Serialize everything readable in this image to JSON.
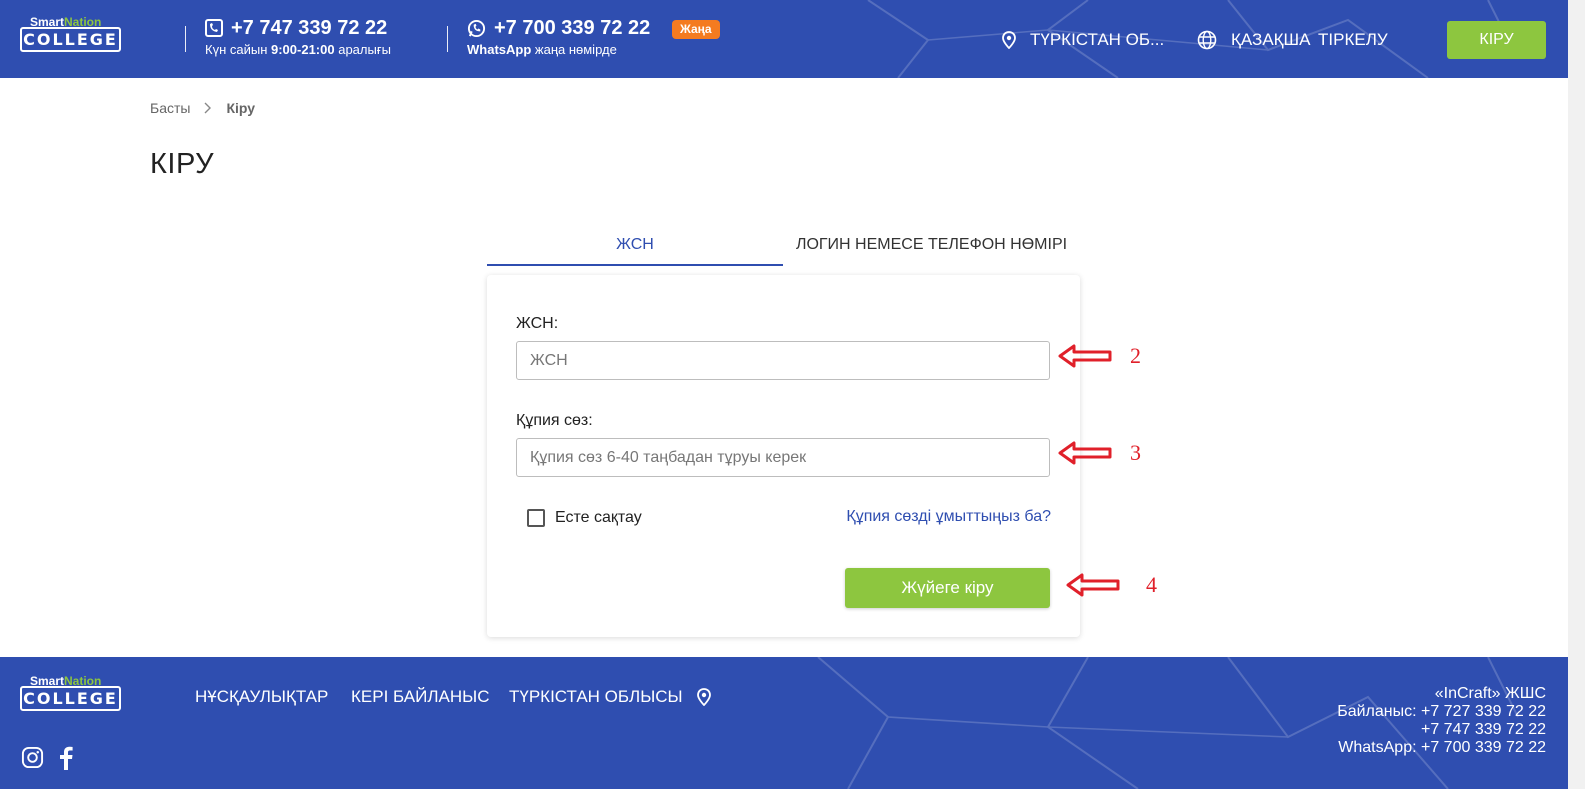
{
  "header": {
    "logo": {
      "top": "SmartNation",
      "top_a": "Smart",
      "top_b": "Nation",
      "bottom": "COLLEGE"
    },
    "phone1": {
      "number": "+7 747 339 72 22",
      "sub_prefix": "Күн сайын ",
      "sub_hours": "9:00-21:00",
      "sub_suffix": " аралығы"
    },
    "phone2": {
      "number": "+7 700 339 72 22",
      "sub_app": "WhatsApp",
      "sub_suffix": " жаңа нөмірде",
      "badge": "Жаңа"
    },
    "region": "ТҮРКІСТАН ОБ...",
    "language": "ҚАЗАҚША",
    "register": "ТІРКЕЛУ",
    "login": "КІРУ"
  },
  "breadcrumb": {
    "home": "Басты",
    "current": "Кіру"
  },
  "page_title": "КІРУ",
  "tabs": {
    "iin": "ЖСН",
    "login": "ЛОГИН НЕМЕСЕ ТЕЛЕФОН НӨМІРІ"
  },
  "form": {
    "iin_label": "ЖСН:",
    "iin_placeholder": "ЖСН",
    "password_label": "Құпия сөз:",
    "password_placeholder": "Құпия сөз 6-40 таңбадан тұруы керек",
    "remember": "Есте сақтау",
    "forgot": "Құпия сөзді ұмыттыңыз ба?",
    "submit": "Жүйеге кіру"
  },
  "annotations": [
    "2",
    "3",
    "4"
  ],
  "footer": {
    "nav": [
      "НҰСҚАУЛЫҚТАР",
      "КЕРІ БАЙЛАНЫС",
      "ТҮРКІСТАН ОБЛЫСЫ"
    ],
    "contact": [
      "«InCraft» ЖШС",
      "Байланыс: +7 727 339 72 22",
      "+7 747 339 72 22",
      "WhatsApp: +7 700 339 72 22"
    ]
  },
  "colors": {
    "primary": "#2f4eb0",
    "accent": "#8dc63f",
    "badge": "#f47b20",
    "annotation": "#e0202a"
  },
  "icons": [
    "phone-icon",
    "whatsapp-icon",
    "location-pin-icon",
    "globe-icon",
    "chevron-right-icon",
    "arrow-left-icon",
    "instagram-icon",
    "facebook-icon"
  ]
}
